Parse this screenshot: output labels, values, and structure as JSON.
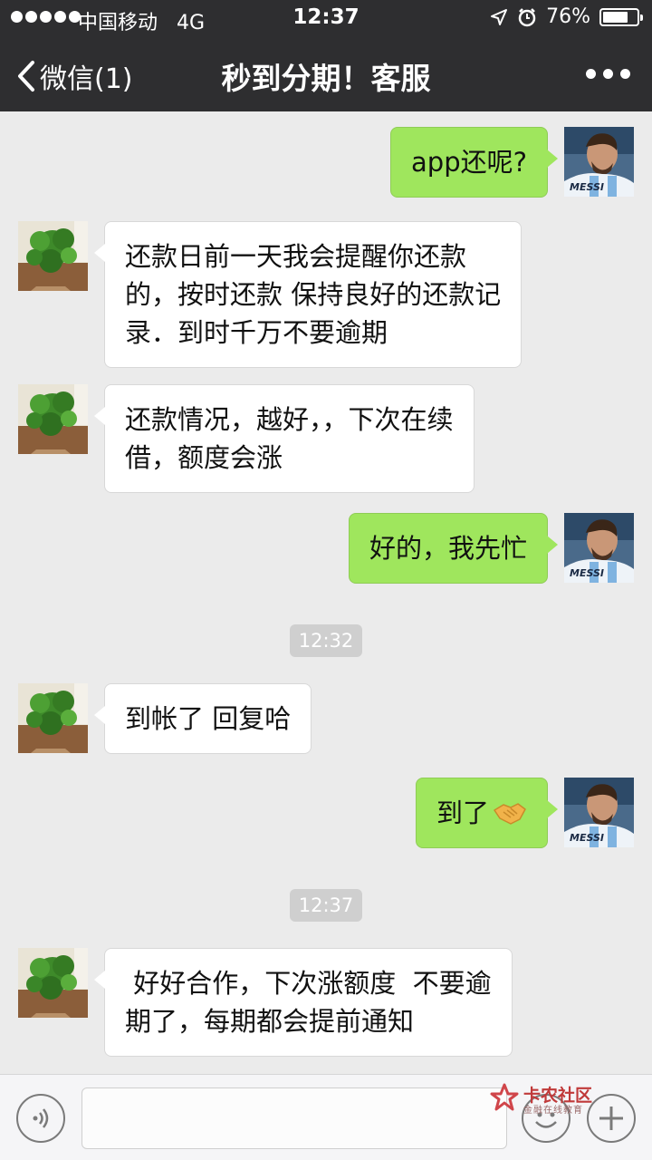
{
  "status": {
    "carrier": "中国移动",
    "network": "4G",
    "time": "12:37",
    "battery_pct": "76%",
    "battery_level": 0.76
  },
  "nav": {
    "back_label": "微信(1)",
    "title": "秒到分期！客服"
  },
  "messages": [
    {
      "side": "self",
      "text": "app还呢?"
    },
    {
      "side": "other",
      "text": "还款日前一天我会提醒你还款\n的，按时还款 保持良好的还款记\n录．到时千万不要逾期"
    },
    {
      "side": "other",
      "text": "还款情况，越好，，下次在续\n借，额度会涨"
    },
    {
      "side": "self",
      "text": "好的，我先忙"
    },
    {
      "timestamp": "12:32"
    },
    {
      "side": "other",
      "text": "到帐了 回复哈"
    },
    {
      "side": "self",
      "text": "到了",
      "emoji": "handshake"
    },
    {
      "timestamp": "12:37"
    },
    {
      "side": "other",
      "text": " 好好合作，下次涨额度  不要逾\n期了，每期都会提前通知"
    }
  ],
  "self_avatar": {
    "jersey_text": "MESSI"
  },
  "watermark": {
    "name": "卡农社区",
    "subtitle": "金融在线教育"
  }
}
